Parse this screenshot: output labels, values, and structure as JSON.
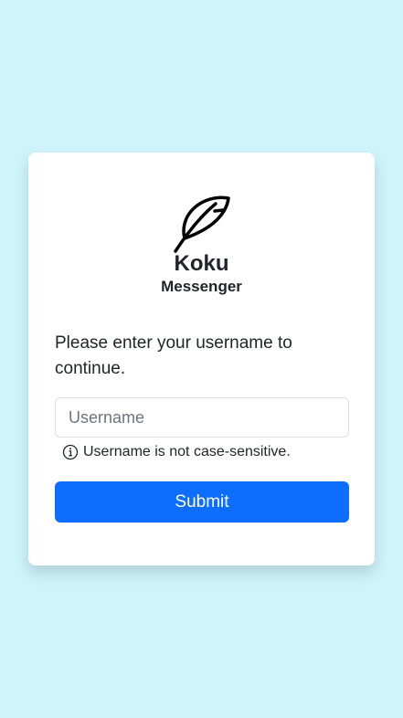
{
  "brand": {
    "icon": "feather-icon",
    "name": "Koku",
    "subtitle": "Messenger"
  },
  "form": {
    "prompt": "Please enter your username to continue.",
    "username": {
      "placeholder": "Username",
      "value": ""
    },
    "hint": {
      "icon": "info-circle-icon",
      "text": "Username is not case-sensitive."
    },
    "submit_label": "Submit"
  },
  "colors": {
    "background": "#cff4fc",
    "card": "#ffffff",
    "primary": "#0d6efd"
  }
}
